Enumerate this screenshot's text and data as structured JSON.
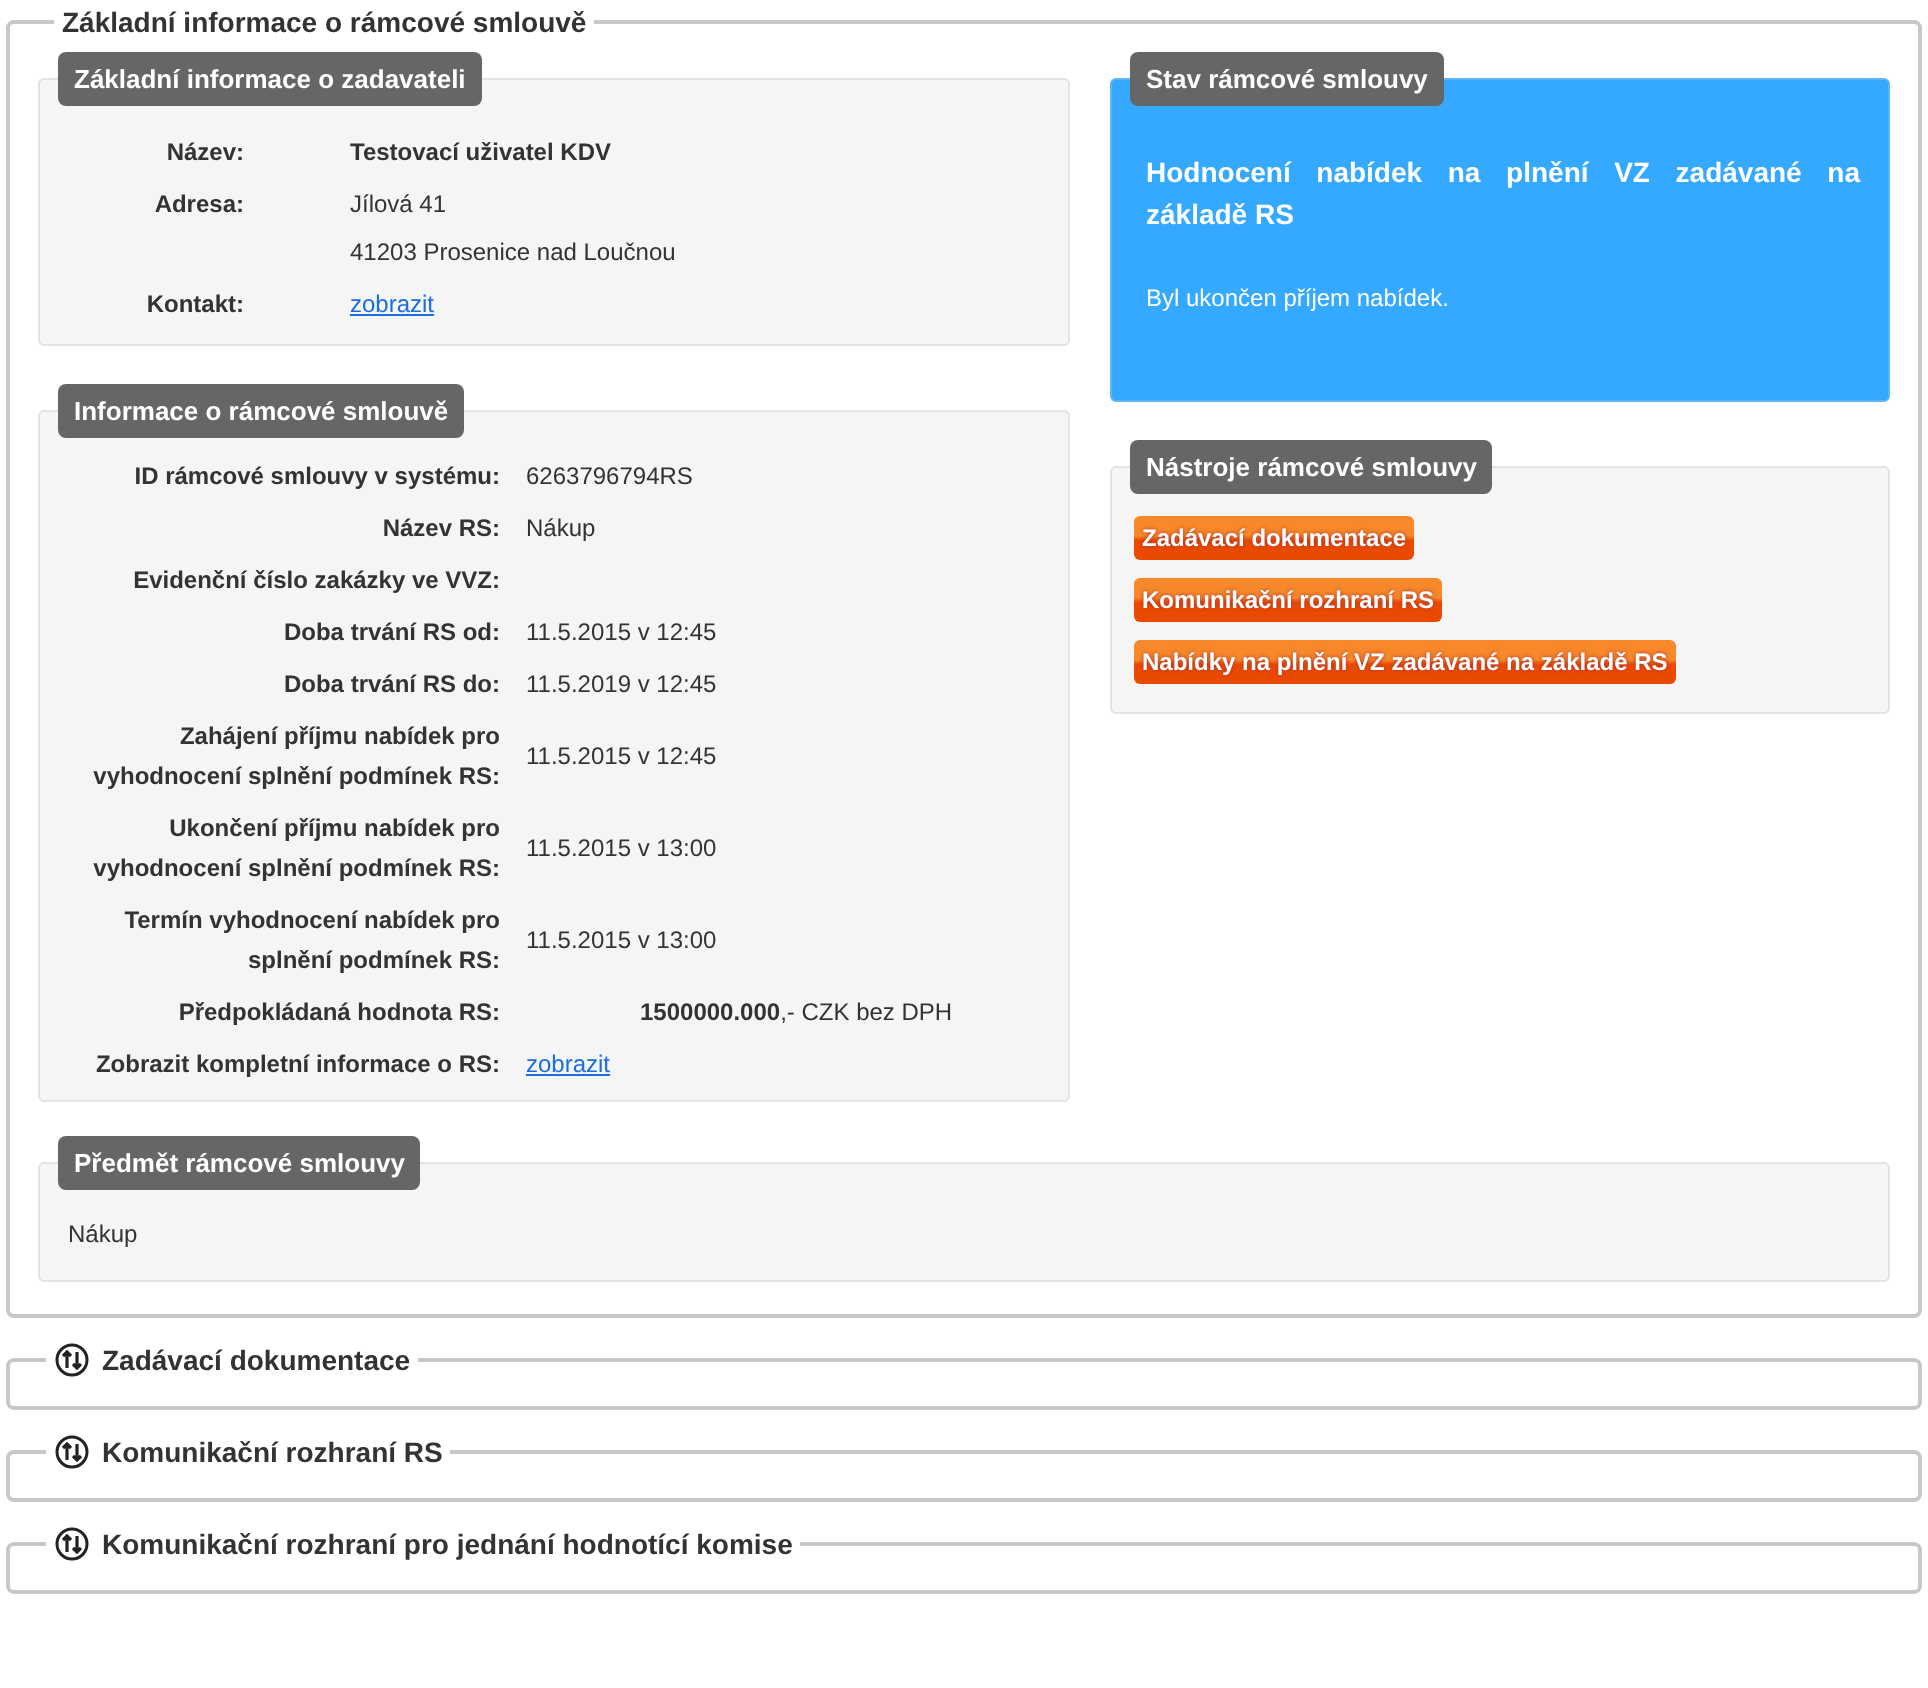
{
  "main_section": {
    "title": "Základní informace o rámcové smlouvě",
    "contracting_authority": {
      "title": "Základní informace o zadavateli",
      "rows": [
        {
          "label": "Název:",
          "values": [
            "Testovací uživatel KDV"
          ],
          "kind": "bold"
        },
        {
          "label": "Adresa:",
          "values": [
            "Jílová 41",
            "41203 Prosenice nad Loučnou"
          ],
          "kind": "text"
        },
        {
          "label": "Kontakt:",
          "values": [
            "zobrazit"
          ],
          "kind": "link"
        }
      ]
    },
    "contract_info": {
      "title": "Informace o rámcové smlouvě",
      "rows": [
        {
          "label": "ID rámcové smlouvy v systému:",
          "value": "6263796794RS",
          "kind": "text"
        },
        {
          "label": "Název RS:",
          "value": "Nákup",
          "kind": "text"
        },
        {
          "label": "Evidenční číslo zakázky ve VVZ:"
        },
        {
          "label": "Doba trvání RS od:",
          "value": "11.5.2015 v 12:45",
          "kind": "text"
        },
        {
          "label": "Doba trvání RS do:",
          "value": "11.5.2019 v 12:45",
          "kind": "text"
        },
        {
          "label": "Zahájení příjmu nabídek pro vyhodnocení splnění podmínek RS:",
          "value": "11.5.2015 v 12:45",
          "kind": "text"
        },
        {
          "label": "Ukončení příjmu nabídek pro vyhodnocení splnění podmínek RS:",
          "value": "11.5.2015 v 13:00",
          "kind": "text"
        },
        {
          "label": "Termín vyhodnocení nabídek pro splnění podmínek RS:",
          "value": "11.5.2015 v 13:00",
          "kind": "text"
        },
        {
          "label": "Předpokládaná hodnota RS:",
          "value": "**1500000.000**,- CZK bez DPH",
          "kind": "amount"
        },
        {
          "label": "Zobrazit kompletní informace o RS:",
          "value": "zobrazit",
          "kind": "link"
        }
      ]
    },
    "status": {
      "title": "Stav rámcové smlouvy",
      "heading": "Hodnocení nabídek na plnění VZ zadávané na základě RS",
      "message": "Byl ukončen příjem nabídek."
    },
    "tools": {
      "title": "Nástroje rámcové smlouvy",
      "buttons": [
        "Zadávací dokumentace",
        "Komunikační rozhraní RS",
        "Nabídky na plnění VZ zadávané na základě RS"
      ]
    },
    "subject": {
      "title": "Předmět rámcové smlouvy",
      "text": "Nákup"
    }
  },
  "collapsed_sections": [
    {
      "title": "Zadávací dokumentace"
    },
    {
      "title": "Komunikační rozhraní RS"
    },
    {
      "title": "Komunikační rozhraní pro jednání hodnotící komise"
    }
  ]
}
